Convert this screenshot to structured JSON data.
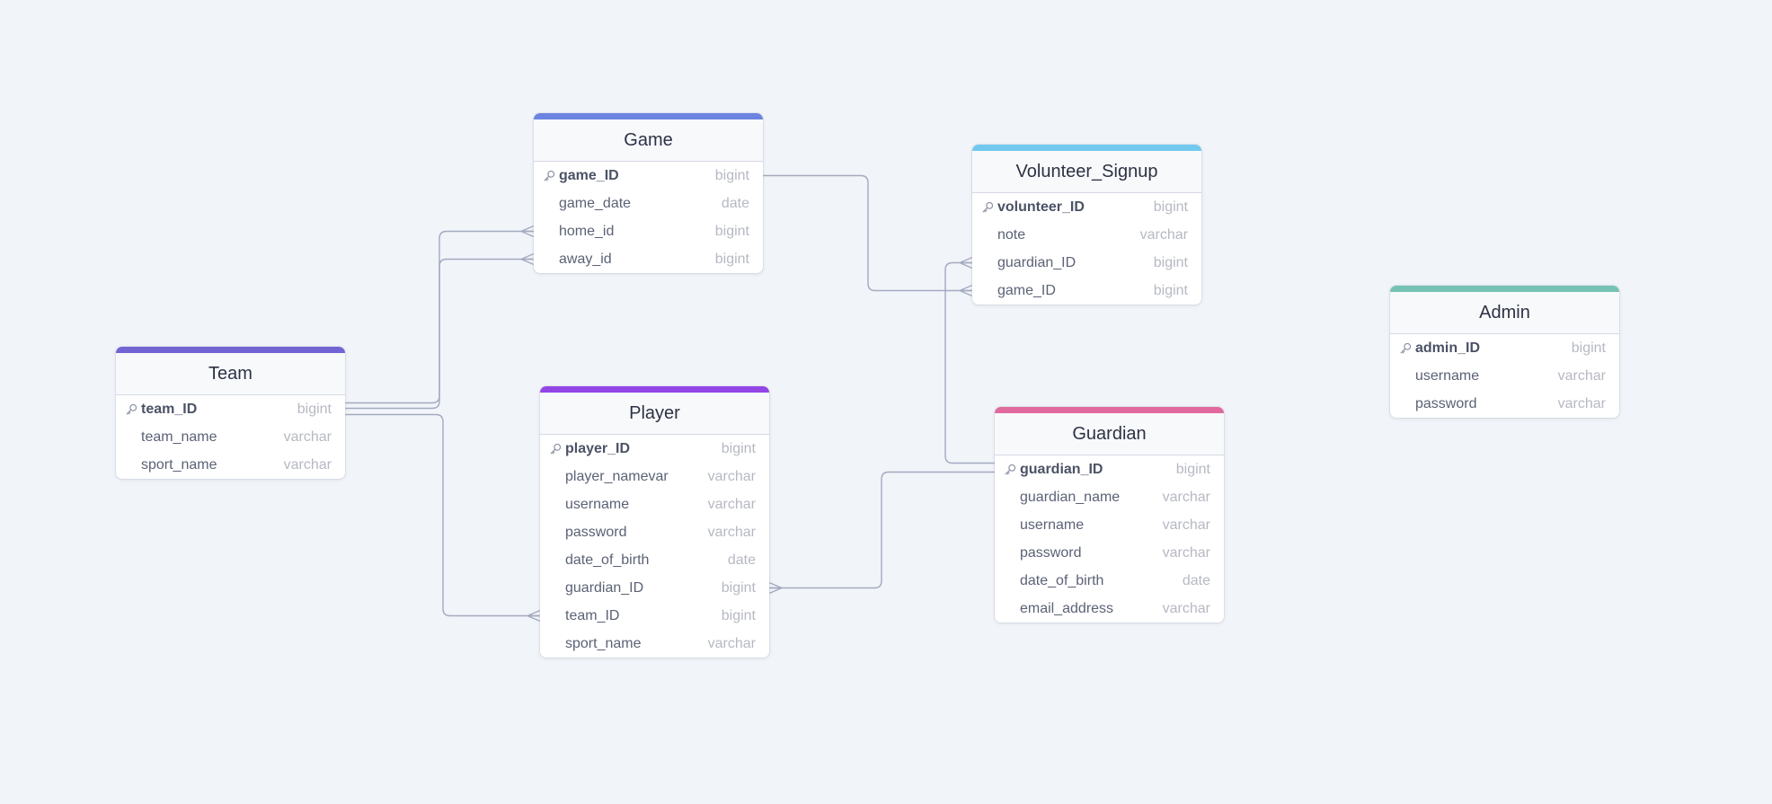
{
  "diagram": {
    "tables": [
      {
        "id": "game",
        "title": "Game",
        "accent": "#6b84e0",
        "columns": [
          {
            "name": "game_ID",
            "type": "bigint",
            "pk": true
          },
          {
            "name": "game_date",
            "type": "date",
            "pk": false
          },
          {
            "name": "home_id",
            "type": "bigint",
            "pk": false
          },
          {
            "name": "away_id",
            "type": "bigint",
            "pk": false
          }
        ]
      },
      {
        "id": "team",
        "title": "Team",
        "accent": "#7264d4",
        "columns": [
          {
            "name": "team_ID",
            "type": "bigint",
            "pk": true
          },
          {
            "name": "team_name",
            "type": "varchar",
            "pk": false
          },
          {
            "name": "sport_name",
            "type": "varchar",
            "pk": false
          }
        ]
      },
      {
        "id": "player",
        "title": "Player",
        "accent": "#9346e6",
        "columns": [
          {
            "name": "player_ID",
            "type": "bigint",
            "pk": true
          },
          {
            "name": "player_namevar",
            "type": "varchar",
            "pk": false
          },
          {
            "name": "username",
            "type": "varchar",
            "pk": false
          },
          {
            "name": "password",
            "type": "varchar",
            "pk": false
          },
          {
            "name": "date_of_birth",
            "type": "date",
            "pk": false
          },
          {
            "name": "guardian_ID",
            "type": "bigint",
            "pk": false
          },
          {
            "name": "team_ID",
            "type": "bigint",
            "pk": false
          },
          {
            "name": "sport_name",
            "type": "varchar",
            "pk": false
          }
        ]
      },
      {
        "id": "volunteer_signup",
        "title": "Volunteer_Signup",
        "accent": "#72c9ee",
        "columns": [
          {
            "name": "volunteer_ID",
            "type": "bigint",
            "pk": true
          },
          {
            "name": "note",
            "type": "varchar",
            "pk": false
          },
          {
            "name": "guardian_ID",
            "type": "bigint",
            "pk": false
          },
          {
            "name": "game_ID",
            "type": "bigint",
            "pk": false
          }
        ]
      },
      {
        "id": "guardian",
        "title": "Guardian",
        "accent": "#e06a9e",
        "columns": [
          {
            "name": "guardian_ID",
            "type": "bigint",
            "pk": true
          },
          {
            "name": "guardian_name",
            "type": "varchar",
            "pk": false
          },
          {
            "name": "username",
            "type": "varchar",
            "pk": false
          },
          {
            "name": "password",
            "type": "varchar",
            "pk": false
          },
          {
            "name": "date_of_birth",
            "type": "date",
            "pk": false
          },
          {
            "name": "email_address",
            "type": "varchar",
            "pk": false
          }
        ]
      },
      {
        "id": "admin",
        "title": "Admin",
        "accent": "#76c2b2",
        "columns": [
          {
            "name": "admin_ID",
            "type": "bigint",
            "pk": true
          },
          {
            "name": "username",
            "type": "varchar",
            "pk": false
          },
          {
            "name": "password",
            "type": "varchar",
            "pk": false
          }
        ]
      }
    ],
    "relationships": [
      {
        "from": "team.team_ID",
        "to": "game.home_id",
        "cardinality": "one-to-many"
      },
      {
        "from": "team.team_ID",
        "to": "game.away_id",
        "cardinality": "one-to-many"
      },
      {
        "from": "team.team_ID",
        "to": "player.team_ID",
        "cardinality": "one-to-many"
      },
      {
        "from": "game.game_ID",
        "to": "volunteer_signup.game_ID",
        "cardinality": "one-to-many"
      },
      {
        "from": "guardian.guardian_ID",
        "to": "volunteer_signup.guardian_ID",
        "cardinality": "one-to-many"
      },
      {
        "from": "guardian.guardian_ID",
        "to": "player.guardian_ID",
        "cardinality": "one-to-many"
      }
    ],
    "line_color": "#a3aac0",
    "key_icon": "key-icon"
  }
}
